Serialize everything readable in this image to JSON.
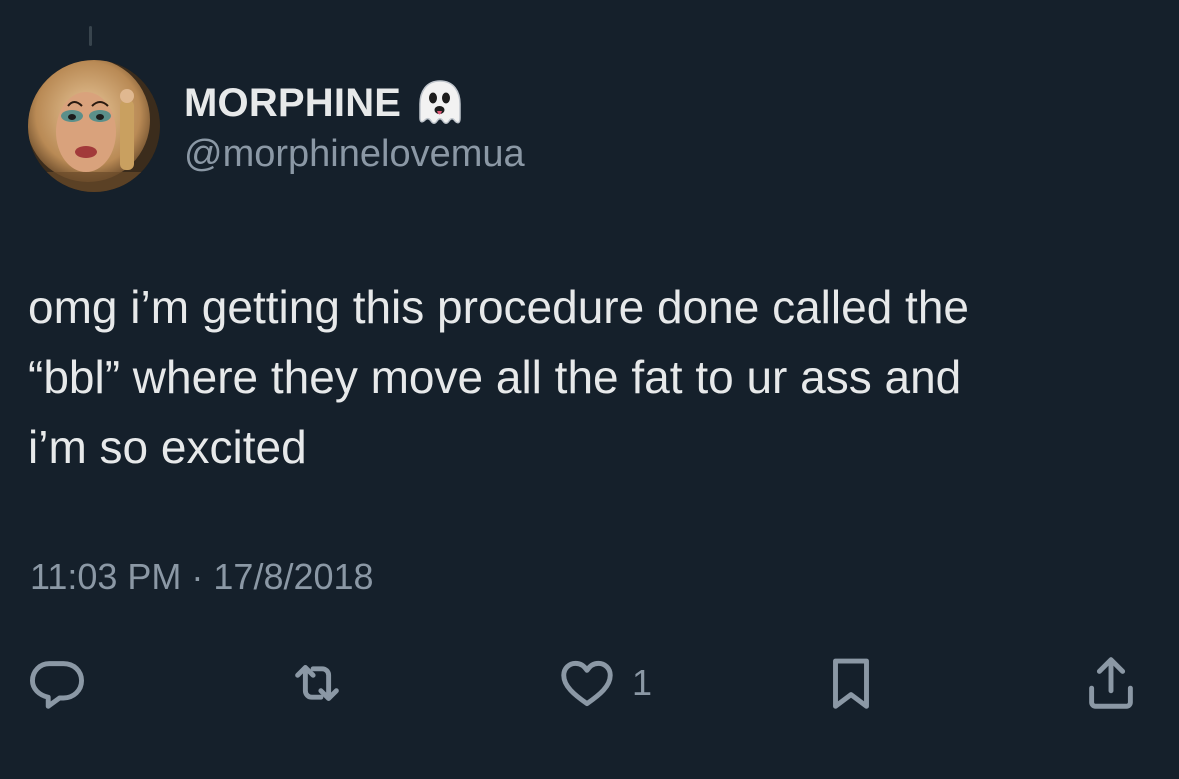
{
  "tweet": {
    "display_name": "MORPHINE",
    "name_emoji": "ghost-emoji",
    "handle": "@morphinelovemua",
    "text": "omg i’m getting this procedure done called the\n“bbl” where they move all the fat to ur ass and\ni’m so excited",
    "timestamp": "11:03 PM · 17/8/2018"
  },
  "actions": {
    "reply_icon": "reply-icon",
    "retweet_icon": "retweet-icon",
    "like_icon": "heart-icon",
    "like_count": "1",
    "bookmark_icon": "bookmark-icon",
    "share_icon": "share-icon"
  },
  "colors": {
    "background": "#15202b",
    "primary_text": "#e7e9ea",
    "secondary_text": "#8b98a5"
  }
}
